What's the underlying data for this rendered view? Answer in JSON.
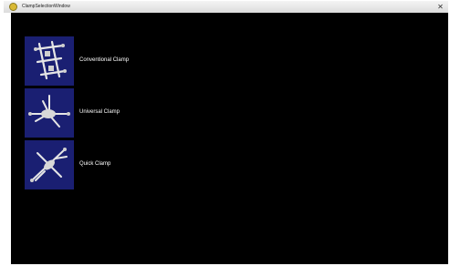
{
  "window": {
    "title": "ClampSelectionWindow",
    "close_glyph": "✕"
  },
  "clamp_list": {
    "items": [
      {
        "label": "Conventional Clamp",
        "icon": "conventional-clamp-icon"
      },
      {
        "label": "Universal Clamp",
        "icon": "universal-clamp-icon"
      },
      {
        "label": "Quick Clamp",
        "icon": "quick-clamp-icon"
      }
    ]
  },
  "colors": {
    "background": "#000000",
    "thumbnail_background": "#1a1f72",
    "label_text": "#ffffff"
  }
}
